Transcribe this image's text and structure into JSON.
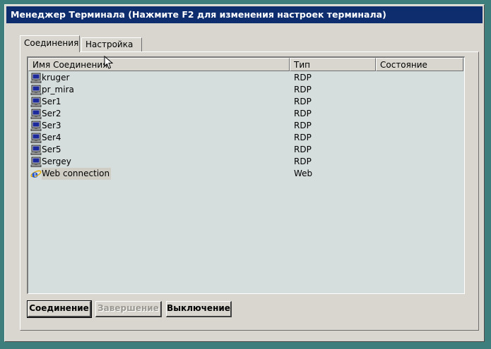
{
  "window": {
    "title": "Менеджер Терминала (Нажмите F2 для изменения настроек терминала)"
  },
  "tabs": [
    {
      "label": "Соединения",
      "active": true
    },
    {
      "label": "Настройка",
      "active": false
    }
  ],
  "list": {
    "columns": [
      "Имя Соединения.",
      "Тип",
      "Состояние"
    ],
    "rows": [
      {
        "name": "kruger",
        "type": "RDP",
        "state": "",
        "icon": "computer-icon"
      },
      {
        "name": "pr_mira",
        "type": "RDP",
        "state": "",
        "icon": "computer-icon"
      },
      {
        "name": "Ser1",
        "type": "RDP",
        "state": "",
        "icon": "computer-icon"
      },
      {
        "name": "Ser2",
        "type": "RDP",
        "state": "",
        "icon": "computer-icon"
      },
      {
        "name": "Ser3",
        "type": "RDP",
        "state": "",
        "icon": "computer-icon"
      },
      {
        "name": "Ser4",
        "type": "RDP",
        "state": "",
        "icon": "computer-icon"
      },
      {
        "name": "Ser5",
        "type": "RDP",
        "state": "",
        "icon": "computer-icon"
      },
      {
        "name": "Sergey",
        "type": "RDP",
        "state": "",
        "icon": "computer-icon"
      },
      {
        "name": "Web connection",
        "type": "Web",
        "state": "",
        "icon": "internet-explorer-icon",
        "selected": true
      }
    ]
  },
  "buttons": {
    "connect": "Соединение",
    "end": "Завершение",
    "shutdown": "Выключение"
  },
  "colors": {
    "desktop": "#3e7e7c",
    "titlebar": "#0d2d6e",
    "window": "#d8d6ce",
    "list_bg": "#d6dedd"
  }
}
